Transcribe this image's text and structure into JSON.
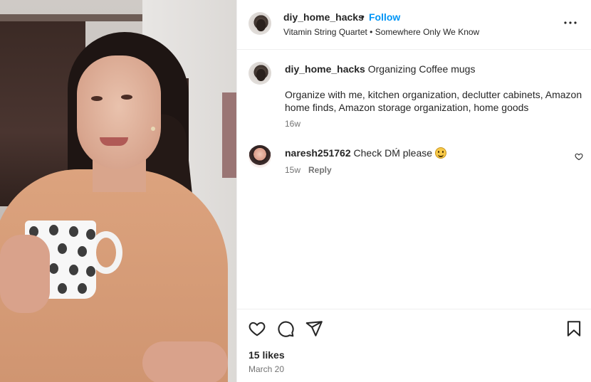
{
  "post": {
    "username": "diy_home_hacks",
    "separator": "•",
    "follow_label": "Follow",
    "music": "Vitamin String Quartet • Somewhere Only We Know",
    "more_icon": "more-horizontal-icon"
  },
  "caption": {
    "username": "diy_home_hacks",
    "title": "Organizing Coffee mugs",
    "body": "Organize with me, kitchen organization, declutter cabinets, Amazon home finds, Amazon storage organization, home goods",
    "time": "16w"
  },
  "comments": [
    {
      "username": "naresh251762",
      "text": "Check DḾ please",
      "emoji": "smiling-face-emoji",
      "time": "15w",
      "reply_label": "Reply"
    }
  ],
  "actions": {
    "like_icon": "heart-icon",
    "comment_icon": "comment-icon",
    "share_icon": "share-icon",
    "save_icon": "bookmark-icon",
    "likes": "15 likes",
    "date": "March 20"
  },
  "colors": {
    "accent": "#0095f6",
    "text": "#262626",
    "muted": "#737373",
    "divider": "#efefef"
  }
}
